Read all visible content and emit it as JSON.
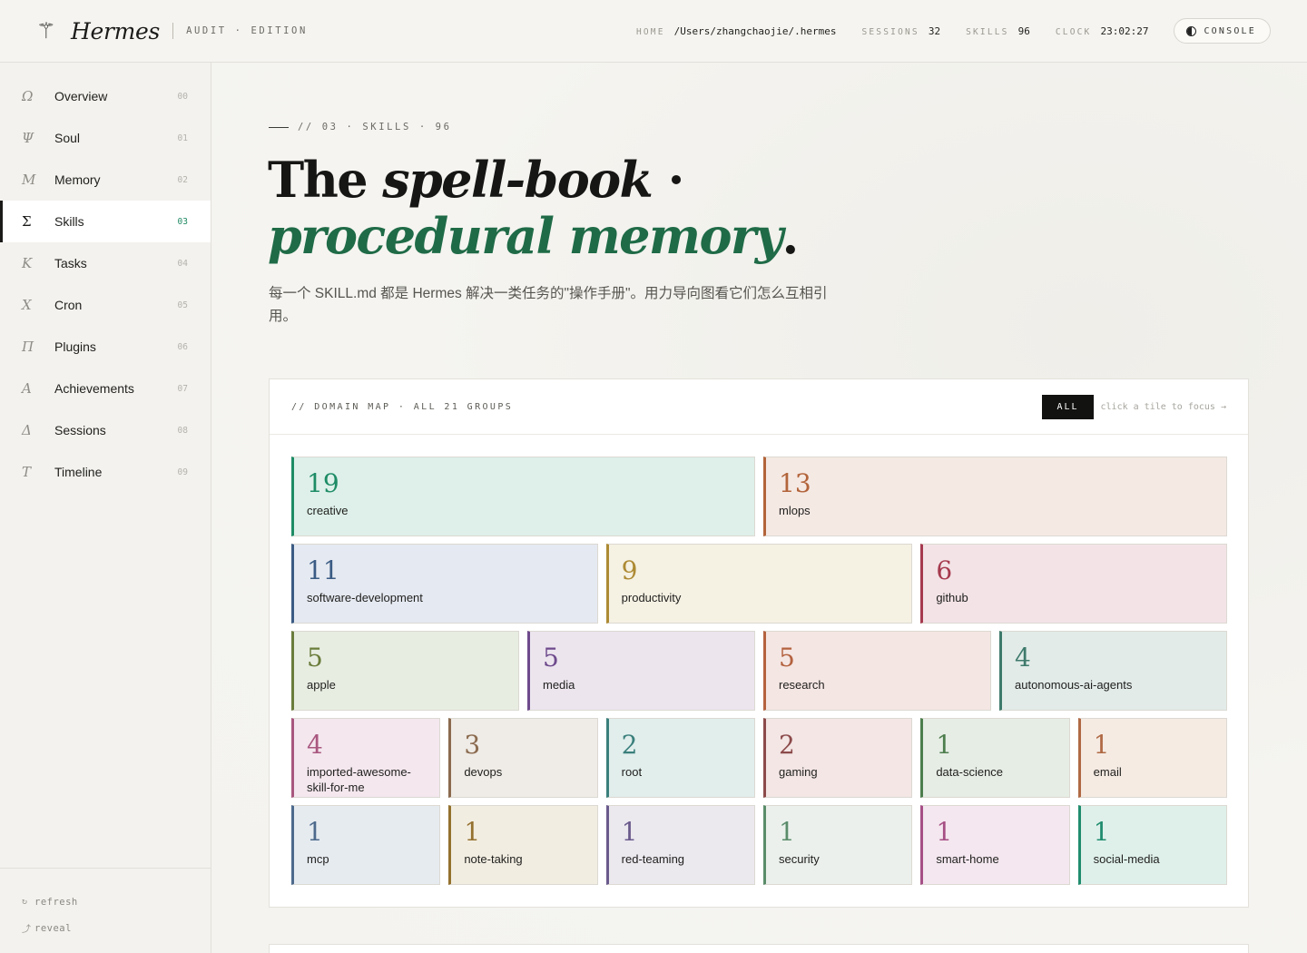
{
  "header": {
    "brand_icon": "⚚",
    "brand_name": "Hermes",
    "edition": "AUDIT · EDITION",
    "stats": [
      {
        "label": "HOME",
        "value": "/Users/zhangchaojie/.hermes"
      },
      {
        "label": "SESSIONS",
        "value": "32"
      },
      {
        "label": "SKILLS",
        "value": "96"
      },
      {
        "label": "CLOCK",
        "value": "23:02:27"
      }
    ],
    "console_label": "CONSOLE"
  },
  "sidebar": {
    "items": [
      {
        "glyph": "Ω",
        "label": "Overview",
        "num": "00"
      },
      {
        "glyph": "Ψ",
        "label": "Soul",
        "num": "01"
      },
      {
        "glyph": "M",
        "label": "Memory",
        "num": "02"
      },
      {
        "glyph": "Σ",
        "label": "Skills",
        "num": "03",
        "active": true
      },
      {
        "glyph": "K",
        "label": "Tasks",
        "num": "04"
      },
      {
        "glyph": "X",
        "label": "Cron",
        "num": "05"
      },
      {
        "glyph": "Π",
        "label": "Plugins",
        "num": "06"
      },
      {
        "glyph": "A",
        "label": "Achievements",
        "num": "07"
      },
      {
        "glyph": "Δ",
        "label": "Sessions",
        "num": "08"
      },
      {
        "glyph": "T",
        "label": "Timeline",
        "num": "09"
      }
    ],
    "footer": [
      {
        "glyph": "↻",
        "label": "refresh"
      },
      {
        "glyph": "⤴",
        "label": "reveal"
      }
    ]
  },
  "main": {
    "kicker": "// 03 · SKILLS · 96",
    "headline_plain": "The ",
    "headline_italic": "spell-book",
    "headline_mid": " ·",
    "headline_green": "procedural memory",
    "headline_end": ".",
    "subtitle": "每一个 SKILL.md 都是 Hermes 解决一类任务的\"操作手册\"。用力导向图看它们怎么互相引用。",
    "panel": {
      "title": "// DOMAIN MAP · ALL 21 GROUPS",
      "all_label": "ALL",
      "hint": "click a tile to focus →",
      "groups": [
        {
          "name": "creative",
          "count": "19",
          "color": "#1e8c66",
          "bg": "#def0e9"
        },
        {
          "name": "mlops",
          "count": "13",
          "color": "#b2643a",
          "bg": "#f5e9e4"
        },
        {
          "name": "software-development",
          "count": "11",
          "color": "#3b5b84",
          "bg": "#e5e9f1"
        },
        {
          "name": "productivity",
          "count": "9",
          "color": "#ad8a33",
          "bg": "#f5f1e3"
        },
        {
          "name": "github",
          "count": "6",
          "color": "#a63a4e",
          "bg": "#f3e3e7"
        },
        {
          "name": "apple",
          "count": "5",
          "color": "#6a7d3b",
          "bg": "#e8ede2"
        },
        {
          "name": "media",
          "count": "5",
          "color": "#6e4a8c",
          "bg": "#ece5ee"
        },
        {
          "name": "research",
          "count": "5",
          "color": "#b4623f",
          "bg": "#f4e6e3"
        },
        {
          "name": "autonomous-ai-agents",
          "count": "4",
          "color": "#3e7a6c",
          "bg": "#e2ebe8"
        },
        {
          "name": "imported-awesome-skill-for-me",
          "count": "4",
          "color": "#a9577f",
          "bg": "#f4e7ee"
        },
        {
          "name": "devops",
          "count": "3",
          "color": "#8a6a4e",
          "bg": "#efebe6"
        },
        {
          "name": "root",
          "count": "2",
          "color": "#3a7f7c",
          "bg": "#e1eeec"
        },
        {
          "name": "gaming",
          "count": "2",
          "color": "#8c4a4a",
          "bg": "#f3e6e5"
        },
        {
          "name": "data-science",
          "count": "1",
          "color": "#4d7d4d",
          "bg": "#e6ede5"
        },
        {
          "name": "email",
          "count": "1",
          "color": "#b06a44",
          "bg": "#f5ebe3"
        },
        {
          "name": "mcp",
          "count": "1",
          "color": "#4d6a8c",
          "bg": "#e6ebf0"
        },
        {
          "name": "note-taking",
          "count": "1",
          "color": "#94712f",
          "bg": "#f2ede1"
        },
        {
          "name": "red-teaming",
          "count": "1",
          "color": "#6a5a8c",
          "bg": "#ebe8ee"
        },
        {
          "name": "security",
          "count": "1",
          "color": "#5a8c6a",
          "bg": "#ebf0ec"
        },
        {
          "name": "smart-home",
          "count": "1",
          "color": "#a64f85",
          "bg": "#f4e7ef"
        },
        {
          "name": "social-media",
          "count": "1",
          "color": "#1f8c6e",
          "bg": "#dff0ea"
        }
      ]
    }
  }
}
